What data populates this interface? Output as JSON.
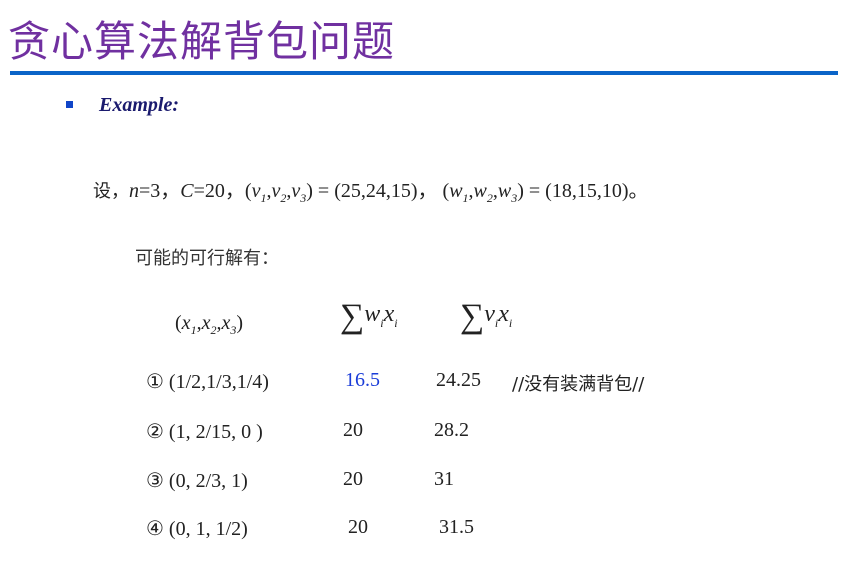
{
  "title": "贪心算法解背包问题",
  "colors": {
    "title": "#7030a0",
    "rule": "#0a64c8",
    "bullet": "#1045c8",
    "highlight": "#1a3cd8"
  },
  "example_label": "Example:",
  "given": {
    "lead": "设，",
    "n_var": "n",
    "n_val": "=3，",
    "c_var": "C",
    "c_val": "=20，",
    "v_open": "(",
    "v_var": "v",
    "v_close": ") = (25,24,15)，",
    "w_open": "(",
    "w_var": "w",
    "w_close": ") = (18,15,10)。",
    "subs": [
      "1",
      "2",
      "3"
    ]
  },
  "feasible_label": "可能的可行解有：",
  "headers": {
    "x_var": "x",
    "sigma": "∑",
    "w": "w",
    "v": "v",
    "i": "i"
  },
  "rows": [
    {
      "solution": "① (1/2,1/3,1/4)",
      "weight": "16.5",
      "value": "24.25",
      "comment": "//没有装满背包//"
    },
    {
      "solution": "② (1, 2/15,  0 )",
      "weight": "20",
      "value": "28.2",
      "comment": ""
    },
    {
      "solution": "③ (0, 2/3,     1)",
      "weight": "20",
      "value": "31",
      "comment": ""
    },
    {
      "solution": "④  (0, 1,     1/2)",
      "weight": "20",
      "value": "31.5",
      "comment": ""
    }
  ]
}
